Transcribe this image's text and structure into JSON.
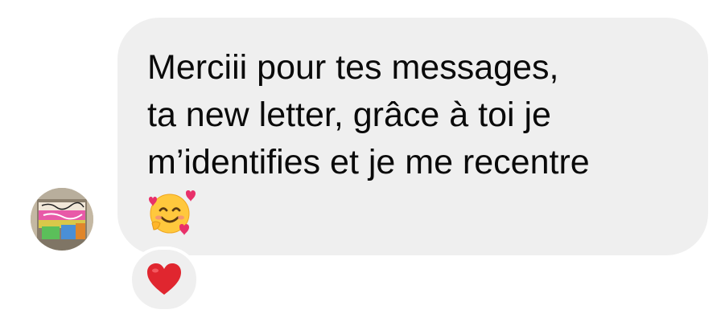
{
  "conversation": {
    "message": {
      "lines": [
        "Merciii pour tes messages,",
        "ta new letter, grâce à toi je",
        "m’identifies et je me recentre"
      ],
      "emoji": "smiling-face-with-hearts",
      "bubble_color": "#efefef",
      "text_color": "#0a0a0a"
    },
    "reaction": {
      "emoji": "red-heart",
      "color": "#e0262f"
    },
    "sender_avatar": {
      "icon": "avatar-photo-graffiti-storefront"
    }
  }
}
